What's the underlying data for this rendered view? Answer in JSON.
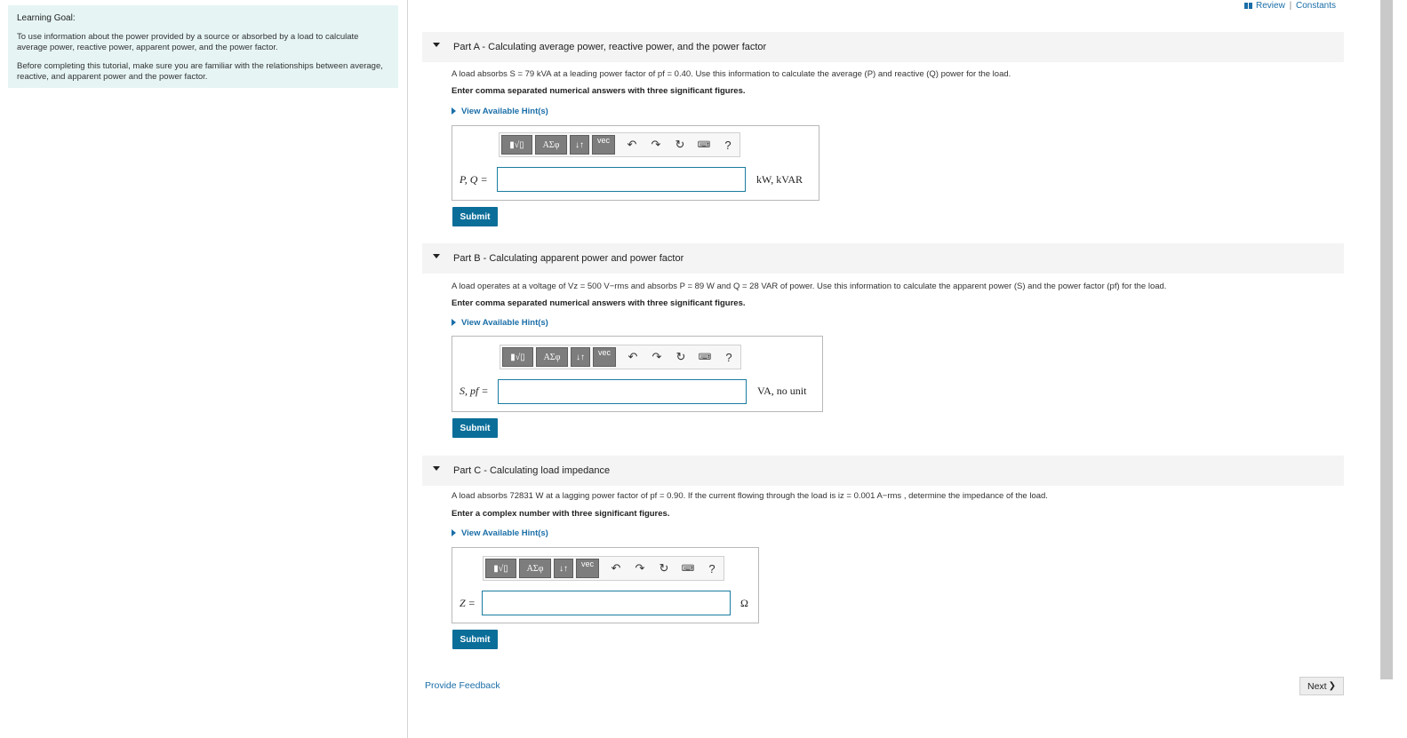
{
  "goal": {
    "heading": "Learning Goal:",
    "p1": "To use information about the power provided by a source or absorbed by a load to calculate average power, reactive power, apparent power, and the power factor.",
    "p2": "Before completing this tutorial, make sure you are familiar with the relationships between average, reactive, and apparent power and the power factor."
  },
  "toplinks": {
    "review": "Review",
    "sep": "|",
    "constants": "Constants"
  },
  "parts": [
    {
      "title": "Part A - Calculating average power, reactive power, and the power factor",
      "question": "A load absorbs S = 79 kVA at a leading power factor of pf = 0.40. Use this information to calculate the average (P) and reactive (Q) power for the load.",
      "instruction": "Enter comma separated numerical answers with three significant figures.",
      "hint": "View Available Hint(s)",
      "label": "P, Q =",
      "units": "kW, kVAR",
      "value": "",
      "submit": "Submit"
    },
    {
      "title": "Part B - Calculating apparent power and power factor",
      "question": "A load operates at a voltage of Vz = 500 V−rms and absorbs P = 89 W and Q = 28 VAR of power. Use this information to calculate the apparent power (S) and the power factor (pf) for the load.",
      "instruction": "Enter comma separated numerical answers with three significant figures.",
      "hint": "View Available Hint(s)",
      "label": "S, pf =",
      "units": "VA, no unit",
      "value": "",
      "submit": "Submit"
    },
    {
      "title": "Part C - Calculating load impedance",
      "question": "A load absorbs 72831 W at a lagging power factor of pf = 0.90. If the current flowing through the load is iz = 0.001 A−rms , determine the impedance of the load.",
      "instruction": "Enter a complex number with three significant figures.",
      "hint": "View Available Hint(s)",
      "label": "Z =",
      "units": "Ω",
      "value": "",
      "submit": "Submit"
    }
  ],
  "toolbar": {
    "templates": "▮√▯",
    "greek": "ΑΣφ",
    "arrows": "↓↑",
    "vec": "vec",
    "undo": "↶",
    "redo": "↷",
    "reset": "↻",
    "keyboard": "⌨",
    "help": "?"
  },
  "footer": {
    "feedback": "Provide Feedback",
    "next": "Next",
    "next_chevron": "❯"
  }
}
